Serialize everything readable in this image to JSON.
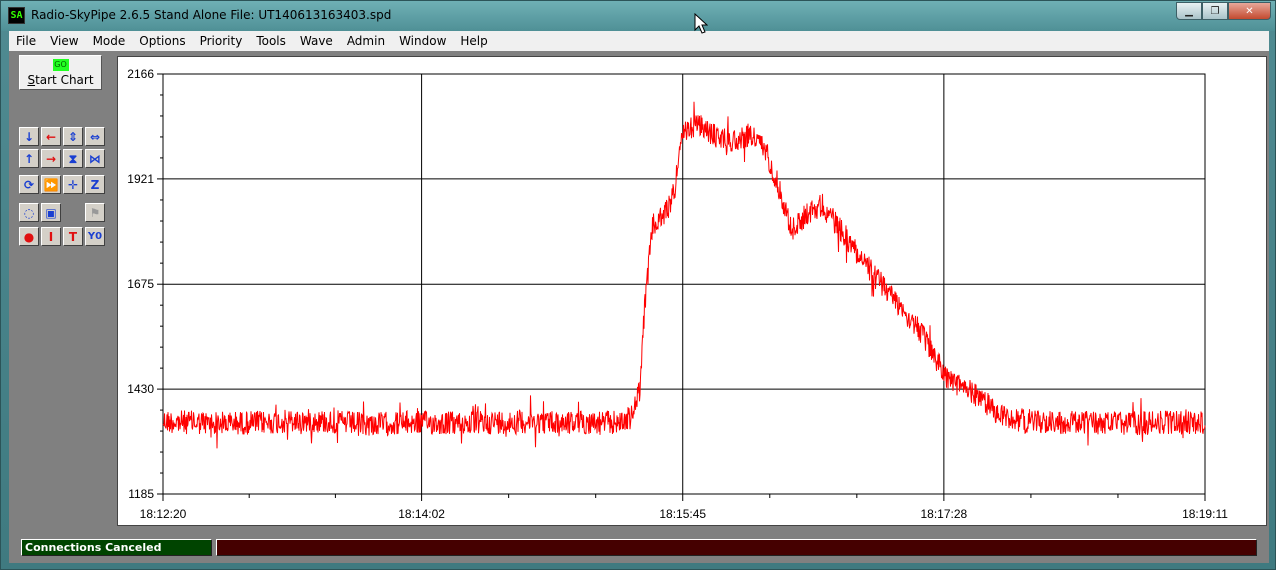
{
  "window": {
    "icon_text": "SA",
    "title": "Radio-SkyPipe  2.6.5   Stand Alone   File: UT140613163403.spd",
    "minimize_icon": "minimize-icon",
    "restore_icon": "restore-icon",
    "close_icon": "close-icon"
  },
  "menu": [
    "File",
    "View",
    "Mode",
    "Options",
    "Priority",
    "Tools",
    "Wave",
    "Admin",
    "Window",
    "Help"
  ],
  "toolbar": {
    "go_badge": "GO",
    "start_label_u": "S",
    "start_label_rest": "tart Chart",
    "buttons": [
      {
        "icon": "arrow-down-icon",
        "glyph": "↓",
        "color": "blue"
      },
      {
        "icon": "arrow-left-icon",
        "glyph": "←",
        "color": "red"
      },
      {
        "icon": "expand-vertical-icon",
        "glyph": "⇕",
        "color": "blue"
      },
      {
        "icon": "expand-horizontal-icon",
        "glyph": "⇔",
        "color": "blue"
      },
      {
        "icon": "arrow-up-icon",
        "glyph": "↑",
        "color": "blue"
      },
      {
        "icon": "arrow-right-icon",
        "glyph": "→",
        "color": "red"
      },
      {
        "icon": "compress-vertical-icon",
        "glyph": "⧗",
        "color": "blue"
      },
      {
        "icon": "compress-horizontal-icon",
        "glyph": "⋈",
        "color": "blue"
      },
      {
        "icon": "refresh-icon",
        "glyph": "⟳",
        "color": "blue"
      },
      {
        "icon": "fast-forward-icon",
        "glyph": "⏩",
        "color": "grey"
      },
      {
        "icon": "crosshair-icon",
        "glyph": "✛",
        "color": "blue"
      },
      {
        "icon": "zoom-box-icon",
        "glyph": "Z",
        "color": "blue"
      },
      {
        "icon": "circle-select-icon",
        "glyph": "◌",
        "color": "blue"
      },
      {
        "icon": "box-select-icon",
        "glyph": "▣",
        "color": "blue"
      },
      {
        "icon": "flag-icon",
        "glyph": "⚑",
        "color": "grey"
      },
      {
        "icon": "record-icon",
        "glyph": "●",
        "color": "red"
      },
      {
        "icon": "text-i-icon",
        "glyph": "I",
        "color": "red"
      },
      {
        "icon": "text-t-icon",
        "glyph": "T",
        "color": "red"
      },
      {
        "icon": "y-zero-icon",
        "glyph": "Y0",
        "color": "blue"
      }
    ]
  },
  "chart_data": {
    "type": "line",
    "title": "",
    "xlabel": "",
    "ylabel": "",
    "x_ticks": [
      "18:12:20",
      "18:14:02",
      "18:15:45",
      "18:17:28",
      "18:19:11"
    ],
    "y_ticks": [
      1185,
      1430,
      1675,
      1921,
      2166
    ],
    "ylim": [
      1185,
      2166
    ],
    "grid": true,
    "series": [
      {
        "color": "#ff0000",
        "x": [
          "18:12:20",
          "18:12:40",
          "18:13:00",
          "18:13:20",
          "18:13:40",
          "18:14:00",
          "18:14:20",
          "18:14:40",
          "18:15:00",
          "18:15:20",
          "18:15:25",
          "18:15:28",
          "18:15:30",
          "18:15:33",
          "18:15:37",
          "18:15:41",
          "18:15:45",
          "18:15:50",
          "18:15:58",
          "18:16:05",
          "18:16:12",
          "18:16:18",
          "18:16:23",
          "18:16:28",
          "18:16:34",
          "18:16:40",
          "18:16:50",
          "18:17:00",
          "18:17:10",
          "18:17:18",
          "18:17:22",
          "18:17:26",
          "18:17:30",
          "18:17:40",
          "18:17:50",
          "18:18:00",
          "18:18:20",
          "18:18:40",
          "18:19:00",
          "18:19:11"
        ],
        "y": [
          1355,
          1350,
          1352,
          1356,
          1348,
          1352,
          1350,
          1355,
          1352,
          1352,
          1365,
          1430,
          1620,
          1810,
          1830,
          1880,
          2020,
          2050,
          2020,
          2010,
          2025,
          1985,
          1900,
          1800,
          1840,
          1860,
          1780,
          1700,
          1630,
          1570,
          1530,
          1490,
          1450,
          1420,
          1370,
          1355,
          1352,
          1350,
          1352,
          1350
        ]
      }
    ]
  },
  "status": {
    "connection": "Connections Canceled"
  }
}
